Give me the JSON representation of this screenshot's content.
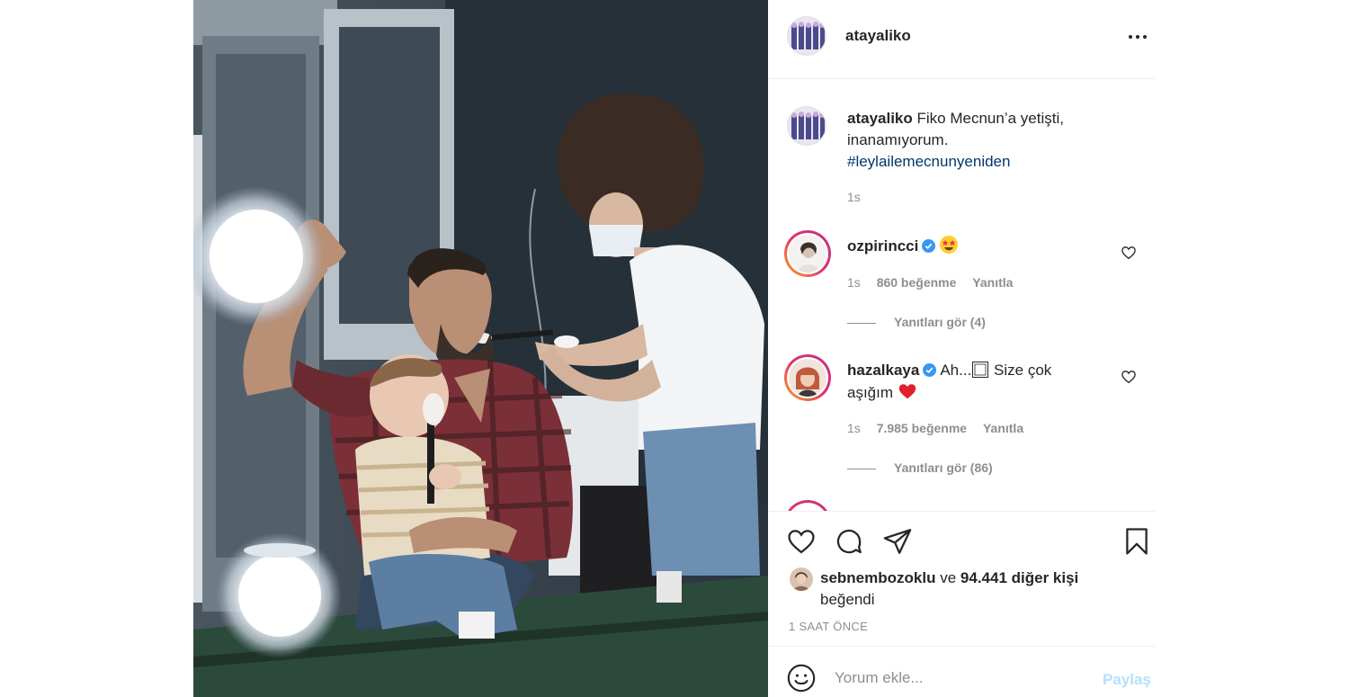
{
  "post": {
    "username": "atayaliko",
    "caption": {
      "username": "atayaliko",
      "text_line1": "Fiko Mecnun’a yetişti,",
      "text_line2": "inanamıyorum.",
      "hashtag": "#leylailemecnunyeniden",
      "time": "1s"
    }
  },
  "comments": [
    {
      "username": "ozpirincci",
      "verified": true,
      "emoji": "star-struck-emoji",
      "time": "1s",
      "likes": "860 beğenme",
      "reply": "Yanıtla",
      "view_replies": "Yanıtları gör (4)"
    },
    {
      "username": "hazalkaya",
      "verified": true,
      "text_a": "Ah...",
      "text_b": " Size çok",
      "text_c": "aşığım",
      "emoji": "red-heart-emoji",
      "time": "1s",
      "likes": "7.985 beğenme",
      "reply": "Yanıtla",
      "view_replies": "Yanıtları gör (86)"
    }
  ],
  "likes": {
    "first_user": "sebnembozoklu",
    "connector": "ve",
    "others": "94.441 diğer kişi",
    "suffix": "beğendi"
  },
  "time_ago": "1 SAAT ÖNCE",
  "add_comment": {
    "placeholder": "Yorum ekle...",
    "post_label": "Paylaş"
  },
  "colors": {
    "link": "#00376b",
    "muted": "#8e8e8e",
    "post_disabled": "#b2dffc",
    "verified": "#3897f0"
  }
}
